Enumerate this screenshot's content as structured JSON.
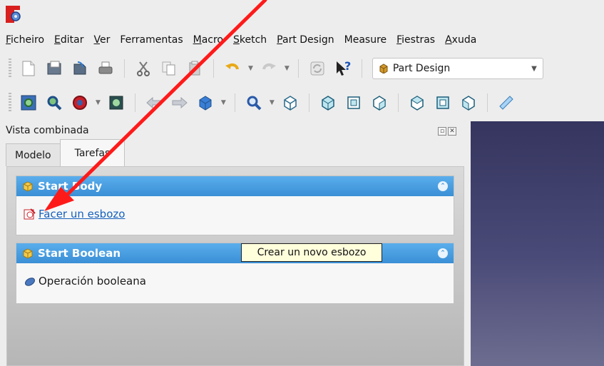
{
  "menubar": {
    "items": [
      {
        "mnemonic": "F",
        "rest": "icheiro"
      },
      {
        "mnemonic": "E",
        "rest": "ditar"
      },
      {
        "mnemonic": "V",
        "rest": "er"
      },
      {
        "mnemonic": "",
        "rest": "Ferramentas"
      },
      {
        "mnemonic": "M",
        "rest": "acro"
      },
      {
        "mnemonic": "S",
        "rest": "ketch"
      },
      {
        "mnemonic": "P",
        "rest": "art Design"
      },
      {
        "mnemonic": "",
        "rest": "Measure"
      },
      {
        "mnemonic": "F",
        "rest": "iestras"
      },
      {
        "mnemonic": "A",
        "rest": "xuda"
      }
    ]
  },
  "toolbar": {
    "workbench": {
      "label": "Part Design",
      "icon": "part-design-workbench-icon"
    }
  },
  "combo_view": {
    "title": "Vista combinada",
    "tabs": [
      {
        "label": "Modelo"
      },
      {
        "label": "Tarefas"
      }
    ],
    "panels": [
      {
        "title": "Start Body",
        "item": "Facer un esbozo",
        "item_icon": "sketch-icon"
      },
      {
        "title": "Start Boolean",
        "item": "Operación booleana",
        "item_icon": "boolean-icon"
      }
    ]
  },
  "tooltip": {
    "text": "Crear un novo esbozo"
  },
  "colors": {
    "panel_header": "#3a8fd6",
    "link": "#1560bd",
    "arrow": "#ff1a1a",
    "viewport": "#35355f"
  }
}
